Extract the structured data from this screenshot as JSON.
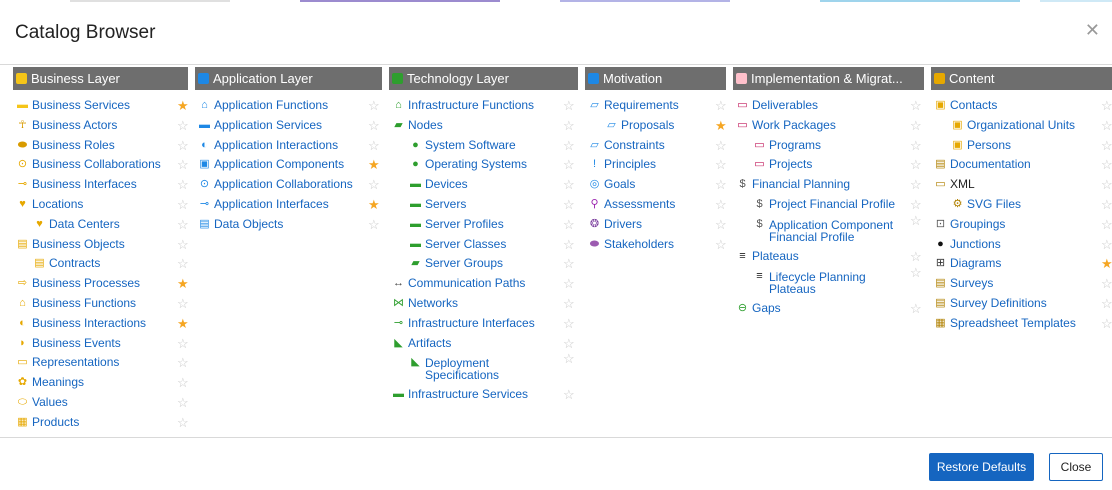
{
  "title": "Catalog Browser",
  "close_icon": "close-icon",
  "colors": {
    "accent": "#1565c0",
    "header_bg": "#6e6e6e",
    "star_favorite": "#f5a623",
    "star_default": "#c8c8c8",
    "top_stripes": [
      "#e0e0e0",
      "#9c8bcf",
      "#b3b3e6",
      "#9fd4ec",
      "#cfe9f6"
    ]
  },
  "columns": [
    {
      "title": "Business Layer",
      "icon": "business-layer-icon",
      "icon_color": "#f5c518",
      "items": [
        {
          "label": "Business Services",
          "level": 1,
          "icon": "business-service-icon",
          "glyph": "▬",
          "icon_color": "#f5c518",
          "favorite": true
        },
        {
          "label": "Business Actors",
          "level": 1,
          "icon": "business-actor-icon",
          "glyph": "☥",
          "icon_color": "#d89b00",
          "favorite": false
        },
        {
          "label": "Business Roles",
          "level": 1,
          "icon": "business-role-icon",
          "glyph": "⬬",
          "icon_color": "#d89b00",
          "favorite": false
        },
        {
          "label": "Business Collaborations",
          "level": 1,
          "icon": "business-collaboration-icon",
          "glyph": "⊙",
          "icon_color": "#e6a800",
          "favorite": false
        },
        {
          "label": "Business Interfaces",
          "level": 1,
          "icon": "business-interface-icon",
          "glyph": "⊸",
          "icon_color": "#e6a800",
          "favorite": false
        },
        {
          "label": "Locations",
          "level": 1,
          "icon": "location-icon",
          "glyph": "♥",
          "icon_color": "#e6a800",
          "favorite": false
        },
        {
          "label": "Data Centers",
          "level": 2,
          "icon": "data-center-icon",
          "glyph": "♥",
          "icon_color": "#e6a800",
          "favorite": false
        },
        {
          "label": "Business Objects",
          "level": 1,
          "icon": "business-object-icon",
          "glyph": "▤",
          "icon_color": "#e6a800",
          "favorite": false
        },
        {
          "label": "Contracts",
          "level": 2,
          "icon": "contract-icon",
          "glyph": "▤",
          "icon_color": "#e6a800",
          "favorite": false
        },
        {
          "label": "Business Processes",
          "level": 1,
          "icon": "business-process-icon",
          "glyph": "⇨",
          "icon_color": "#e6a800",
          "favorite": true
        },
        {
          "label": "Business Functions",
          "level": 1,
          "icon": "business-function-icon",
          "glyph": "⌂",
          "icon_color": "#e6a800",
          "favorite": false
        },
        {
          "label": "Business Interactions",
          "level": 1,
          "icon": "business-interaction-icon",
          "glyph": "◐",
          "icon_color": "#e6a800",
          "favorite": true
        },
        {
          "label": "Business Events",
          "level": 1,
          "icon": "business-event-icon",
          "glyph": "◗",
          "icon_color": "#e6a800",
          "favorite": false
        },
        {
          "label": "Representations",
          "level": 1,
          "icon": "representation-icon",
          "glyph": "▭",
          "icon_color": "#e6a800",
          "favorite": false
        },
        {
          "label": "Meanings",
          "level": 1,
          "icon": "meaning-icon",
          "glyph": "✿",
          "icon_color": "#e6a800",
          "favorite": false
        },
        {
          "label": "Values",
          "level": 1,
          "icon": "value-icon",
          "glyph": "⬭",
          "icon_color": "#e6a800",
          "favorite": false
        },
        {
          "label": "Products",
          "level": 1,
          "icon": "product-icon",
          "glyph": "▦",
          "icon_color": "#e6a800",
          "favorite": false
        }
      ]
    },
    {
      "title": "Application Layer",
      "icon": "application-layer-icon",
      "icon_color": "#1e88e5",
      "items": [
        {
          "label": "Application Functions",
          "level": 1,
          "icon": "application-function-icon",
          "glyph": "⌂",
          "icon_color": "#1e88e5",
          "favorite": false
        },
        {
          "label": "Application Services",
          "level": 1,
          "icon": "application-service-icon",
          "glyph": "▬",
          "icon_color": "#1e88e5",
          "favorite": false
        },
        {
          "label": "Application Interactions",
          "level": 1,
          "icon": "application-interaction-icon",
          "glyph": "◐",
          "icon_color": "#1e88e5",
          "favorite": false
        },
        {
          "label": "Application Components",
          "level": 1,
          "icon": "application-component-icon",
          "glyph": "▣",
          "icon_color": "#1e88e5",
          "favorite": true
        },
        {
          "label": "Application Collaborations",
          "level": 1,
          "icon": "application-collaboration-icon",
          "glyph": "⊙",
          "icon_color": "#1e88e5",
          "favorite": false
        },
        {
          "label": "Application Interfaces",
          "level": 1,
          "icon": "application-interface-icon",
          "glyph": "⊸",
          "icon_color": "#1e88e5",
          "favorite": true
        },
        {
          "label": "Data Objects",
          "level": 1,
          "icon": "data-object-icon",
          "glyph": "▤",
          "icon_color": "#1e88e5",
          "favorite": false
        }
      ]
    },
    {
      "title": "Technology Layer",
      "icon": "technology-layer-icon",
      "icon_color": "#2e9e2e",
      "items": [
        {
          "label": "Infrastructure Functions",
          "level": 1,
          "icon": "infrastructure-function-icon",
          "glyph": "⌂",
          "icon_color": "#2e9e2e",
          "favorite": false
        },
        {
          "label": "Nodes",
          "level": 1,
          "icon": "node-icon",
          "glyph": "▰",
          "icon_color": "#2e9e2e",
          "favorite": false
        },
        {
          "label": "System Software",
          "level": 2,
          "icon": "system-software-icon",
          "glyph": "●",
          "icon_color": "#2e9e2e",
          "favorite": false
        },
        {
          "label": "Operating Systems",
          "level": 2,
          "icon": "operating-system-icon",
          "glyph": "●",
          "icon_color": "#2e9e2e",
          "favorite": false
        },
        {
          "label": "Devices",
          "level": 2,
          "icon": "device-icon",
          "glyph": "▬",
          "icon_color": "#2e9e2e",
          "favorite": false
        },
        {
          "label": "Servers",
          "level": 2,
          "icon": "server-icon",
          "glyph": "▬",
          "icon_color": "#2e9e2e",
          "favorite": false
        },
        {
          "label": "Server Profiles",
          "level": 2,
          "icon": "server-profile-icon",
          "glyph": "▬",
          "icon_color": "#2e9e2e",
          "favorite": false
        },
        {
          "label": "Server Classes",
          "level": 2,
          "icon": "server-class-icon",
          "glyph": "▬",
          "icon_color": "#2e9e2e",
          "favorite": false
        },
        {
          "label": "Server Groups",
          "level": 2,
          "icon": "server-group-icon",
          "glyph": "▰",
          "icon_color": "#2e9e2e",
          "favorite": false
        },
        {
          "label": "Communication Paths",
          "level": 1,
          "icon": "communication-path-icon",
          "glyph": "↔",
          "icon_color": "#444444",
          "favorite": false
        },
        {
          "label": "Networks",
          "level": 1,
          "icon": "network-icon",
          "glyph": "⋈",
          "icon_color": "#2e9e2e",
          "favorite": false
        },
        {
          "label": "Infrastructure Interfaces",
          "level": 1,
          "icon": "infrastructure-interface-icon",
          "glyph": "⊸",
          "icon_color": "#2e9e2e",
          "favorite": false
        },
        {
          "label": "Artifacts",
          "level": 1,
          "icon": "artifact-icon",
          "glyph": "◣",
          "icon_color": "#2e9e2e",
          "favorite": false
        },
        {
          "label": "Deployment Specifications",
          "level": 2,
          "icon": "deployment-specification-icon",
          "glyph": "◣",
          "icon_color": "#2e9e2e",
          "favorite": false,
          "wrap": [
            "Deployment",
            "Specifications"
          ]
        },
        {
          "label": "Infrastructure Services",
          "level": 1,
          "icon": "infrastructure-service-icon",
          "glyph": "▬",
          "icon_color": "#2e9e2e",
          "favorite": false
        }
      ]
    },
    {
      "title": "Motivation",
      "icon": "motivation-icon",
      "icon_color": "#1e88e5",
      "items": [
        {
          "label": "Requirements",
          "level": 1,
          "icon": "requirement-icon",
          "glyph": "▱",
          "icon_color": "#1e88e5",
          "favorite": false
        },
        {
          "label": "Proposals",
          "level": 2,
          "icon": "proposal-icon",
          "glyph": "▱",
          "icon_color": "#1e88e5",
          "favorite": true
        },
        {
          "label": "Constraints",
          "level": 1,
          "icon": "constraint-icon",
          "glyph": "▱",
          "icon_color": "#1e88e5",
          "favorite": false
        },
        {
          "label": "Principles",
          "level": 1,
          "icon": "principle-icon",
          "glyph": "!",
          "icon_color": "#1e88e5",
          "favorite": false
        },
        {
          "label": "Goals",
          "level": 1,
          "icon": "goal-icon",
          "glyph": "◎",
          "icon_color": "#1e88e5",
          "favorite": false
        },
        {
          "label": "Assessments",
          "level": 1,
          "icon": "assessment-icon",
          "glyph": "⚲",
          "icon_color": "#9c27b0",
          "favorite": false
        },
        {
          "label": "Drivers",
          "level": 1,
          "icon": "driver-icon",
          "glyph": "❂",
          "icon_color": "#7b3f9e",
          "favorite": false
        },
        {
          "label": "Stakeholders",
          "level": 1,
          "icon": "stakeholder-icon",
          "glyph": "⬬",
          "icon_color": "#9c5bb0",
          "favorite": false
        }
      ]
    },
    {
      "title": "Implementation & Migrat...",
      "icon": "implementation-migration-icon",
      "icon_color": "#ffc0cb",
      "items": [
        {
          "label": "Deliverables",
          "level": 1,
          "icon": "deliverable-icon",
          "glyph": "▭",
          "icon_color": "#c2185b",
          "favorite": false
        },
        {
          "label": "Work Packages",
          "level": 1,
          "icon": "work-package-icon",
          "glyph": "▭",
          "icon_color": "#c2185b",
          "favorite": false
        },
        {
          "label": "Programs",
          "level": 2,
          "icon": "program-icon",
          "glyph": "▭",
          "icon_color": "#c2185b",
          "favorite": false
        },
        {
          "label": "Projects",
          "level": 2,
          "icon": "project-icon",
          "glyph": "▭",
          "icon_color": "#c2185b",
          "favorite": false
        },
        {
          "label": "Financial Planning",
          "level": 1,
          "icon": "financial-planning-icon",
          "glyph": "$",
          "icon_color": "#555555",
          "favorite": false
        },
        {
          "label": "Project Financial Profile",
          "level": 2,
          "icon": "project-financial-profile-icon",
          "glyph": "$",
          "icon_color": "#555555",
          "favorite": false
        },
        {
          "label": "Application Component Financial Profile",
          "level": 2,
          "icon": "application-component-financial-profile-icon",
          "glyph": "$",
          "icon_color": "#555555",
          "favorite": false,
          "wrap": [
            "Application Component",
            "Financial Profile"
          ]
        },
        {
          "label": "Plateaus",
          "level": 1,
          "icon": "plateau-icon",
          "glyph": "≡",
          "icon_color": "#222222",
          "favorite": false
        },
        {
          "label": "Lifecycle Planning Plateaus",
          "level": 2,
          "icon": "lifecycle-plateau-icon",
          "glyph": "≡",
          "icon_color": "#222222",
          "favorite": false,
          "wrap": [
            "Lifecycle Planning",
            "Plateaus"
          ]
        },
        {
          "label": "Gaps",
          "level": 1,
          "icon": "gap-icon",
          "glyph": "⊖",
          "icon_color": "#2e9e2e",
          "favorite": false
        }
      ]
    },
    {
      "title": "Content",
      "icon": "content-icon",
      "icon_color": "#e6a800",
      "items": [
        {
          "label": "Contacts",
          "level": 1,
          "icon": "contact-icon",
          "glyph": "▣",
          "icon_color": "#e6a800",
          "favorite": false
        },
        {
          "label": "Organizational Units",
          "level": 2,
          "icon": "organizational-unit-icon",
          "glyph": "▣",
          "icon_color": "#e6a800",
          "favorite": false
        },
        {
          "label": "Persons",
          "level": 2,
          "icon": "person-icon",
          "glyph": "▣",
          "icon_color": "#e6a800",
          "favorite": false
        },
        {
          "label": "Documentation",
          "level": 1,
          "icon": "documentation-icon",
          "glyph": "▤",
          "icon_color": "#b08000",
          "favorite": false
        },
        {
          "label": "XML",
          "level": 1,
          "icon": "xml-icon",
          "glyph": "▭",
          "icon_color": "#b08000",
          "favorite": false,
          "plain": true
        },
        {
          "label": "SVG Files",
          "level": 2,
          "icon": "svg-file-icon",
          "glyph": "⚙",
          "icon_color": "#b08000",
          "favorite": false
        },
        {
          "label": "Groupings",
          "level": 1,
          "icon": "grouping-icon",
          "glyph": "⊡",
          "icon_color": "#555555",
          "favorite": false
        },
        {
          "label": "Junctions",
          "level": 1,
          "icon": "junction-icon",
          "glyph": "●",
          "icon_color": "#111111",
          "favorite": false
        },
        {
          "label": "Diagrams",
          "level": 1,
          "icon": "diagram-icon",
          "glyph": "⊞",
          "icon_color": "#333333",
          "favorite": true
        },
        {
          "label": "Surveys",
          "level": 1,
          "icon": "survey-icon",
          "glyph": "▤",
          "icon_color": "#b08000",
          "favorite": false
        },
        {
          "label": "Survey Definitions",
          "level": 1,
          "icon": "survey-definition-icon",
          "glyph": "▤",
          "icon_color": "#b08000",
          "favorite": false
        },
        {
          "label": "Spreadsheet Templates",
          "level": 1,
          "icon": "spreadsheet-template-icon",
          "glyph": "▦",
          "icon_color": "#b08000",
          "favorite": false
        }
      ]
    }
  ],
  "footer": {
    "restore_label": "Restore Defaults",
    "close_label": "Close"
  }
}
